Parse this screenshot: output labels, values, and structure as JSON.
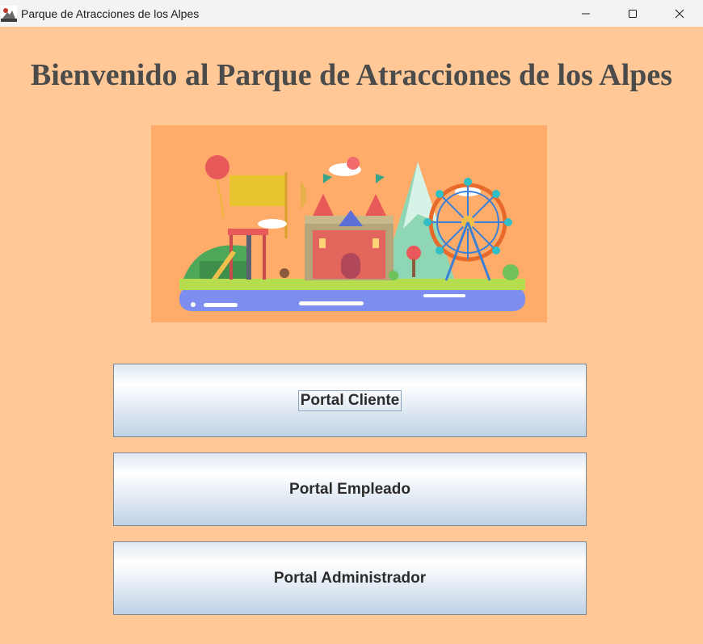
{
  "window": {
    "title": "Parque de Atracciones de los Alpes",
    "controls": [
      "minimize-icon",
      "maximize-icon",
      "close-icon"
    ]
  },
  "main": {
    "heading": "Bienvenido al Parque de Atracciones de los Alpes",
    "banner": "amusement-park-illustration",
    "buttons": [
      {
        "label": "Portal Cliente",
        "focused": true
      },
      {
        "label": "Portal Empleado"
      },
      {
        "label": "Portal Administrador"
      }
    ]
  },
  "colors": {
    "background": "#ffc896",
    "banner_background": "#ffac6a",
    "heading": "#4b4b4b",
    "button_text": "#2b2b2b"
  }
}
